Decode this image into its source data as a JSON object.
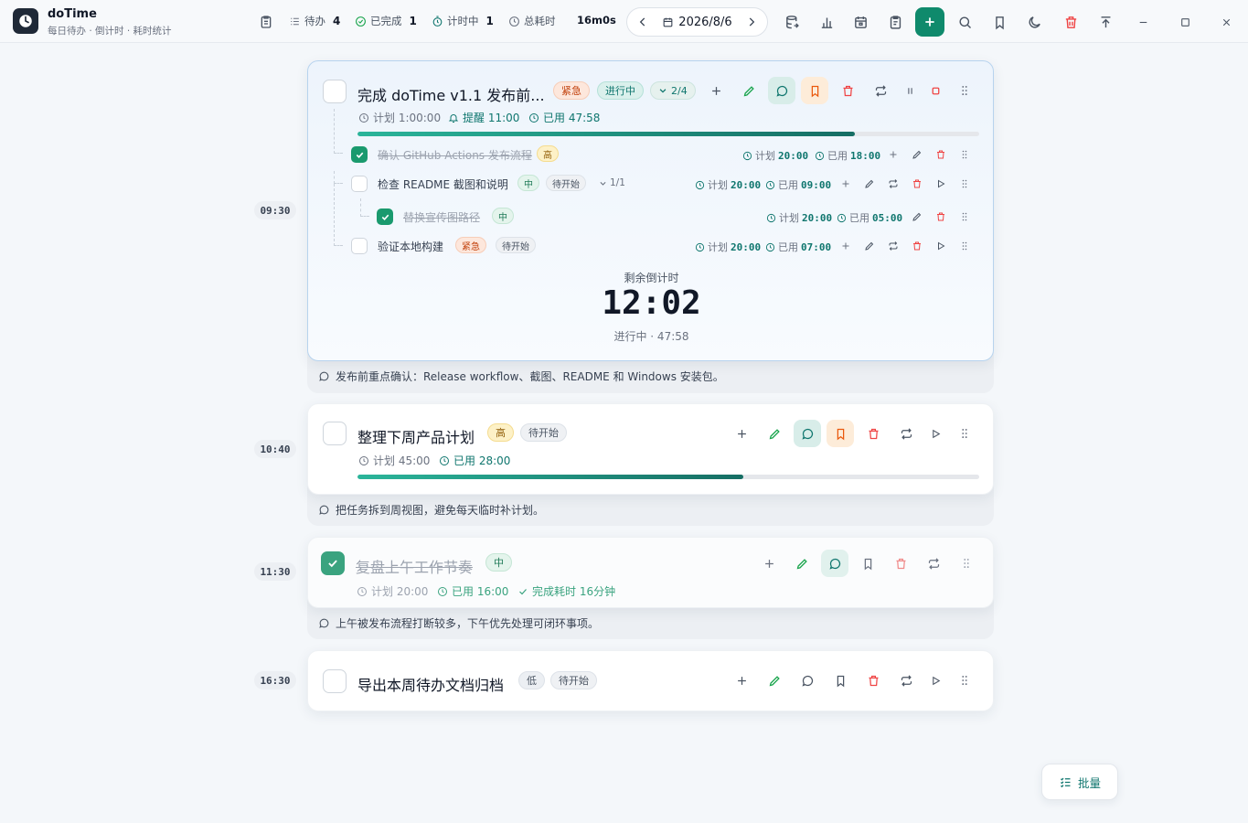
{
  "app": {
    "name": "doTime",
    "tagline": "每日待办 · 倒计时 · 耗时统计"
  },
  "stats": {
    "pending_label": "待办",
    "pending": "4",
    "done_label": "已完成",
    "done": "1",
    "timing_label": "计时中",
    "timing": "1",
    "total_label": "总耗时",
    "total": "16m0s"
  },
  "date": "2026/8/6",
  "colors": {
    "accent": "#0f8a6c",
    "urgent": "#c2410c",
    "danger": "#ef4444"
  },
  "tasks": [
    {
      "time": "09:30",
      "title": "完成 doTime v1.1 发布前...",
      "priority": "紧急",
      "status": "进行中",
      "subtasks": "2/4",
      "plan": "计划 1:00:00",
      "remind": "提醒 11:00",
      "used": "已用 47:58",
      "progress": 0.8,
      "note": "发布前重点确认：Release workflow、截图、README 和 Windows 安装包。",
      "countdown_label": "剩余倒计时",
      "countdown": "12:02",
      "countdown_status": "进行中 · 47:58",
      "children": [
        {
          "title": "确认 GitHub Actions 发布流程",
          "priority": "高",
          "done": true,
          "plan_label": "计划",
          "plan": "20:00",
          "used_label": "已用",
          "used": "18:00"
        },
        {
          "title": "检查 README 截图和说明",
          "priority": "中",
          "status": "待开始",
          "subtasks": "1/1",
          "done": false,
          "plan_label": "计划",
          "plan": "20:00",
          "used_label": "已用",
          "used": "09:00"
        },
        {
          "title": "替换宣传图路径",
          "priority": "中",
          "done": true,
          "plan_label": "计划",
          "plan": "20:00",
          "used_label": "已用",
          "used": "05:00"
        },
        {
          "title": "验证本地构建",
          "priority": "紧急",
          "status": "待开始",
          "done": false,
          "plan_label": "计划",
          "plan": "20:00",
          "used_label": "已用",
          "used": "07:00"
        }
      ]
    },
    {
      "time": "10:40",
      "title": "整理下周产品计划",
      "priority": "高",
      "status": "待开始",
      "plan": "计划 45:00",
      "used": "已用 28:00",
      "progress": 0.62,
      "note": "把任务拆到周视图，避免每天临时补计划。"
    },
    {
      "time": "11:30",
      "title": "复盘上午工作节奏",
      "priority": "中",
      "plan": "计划 20:00",
      "used": "已用 16:00",
      "finished": "完成耗时 16分钟",
      "note": "上午被发布流程打断较多，下午优先处理可闭环事项。"
    },
    {
      "time": "16:30",
      "title": "导出本周待办文档归档",
      "priority": "低",
      "status": "待开始"
    }
  ],
  "batch_label": "批量"
}
